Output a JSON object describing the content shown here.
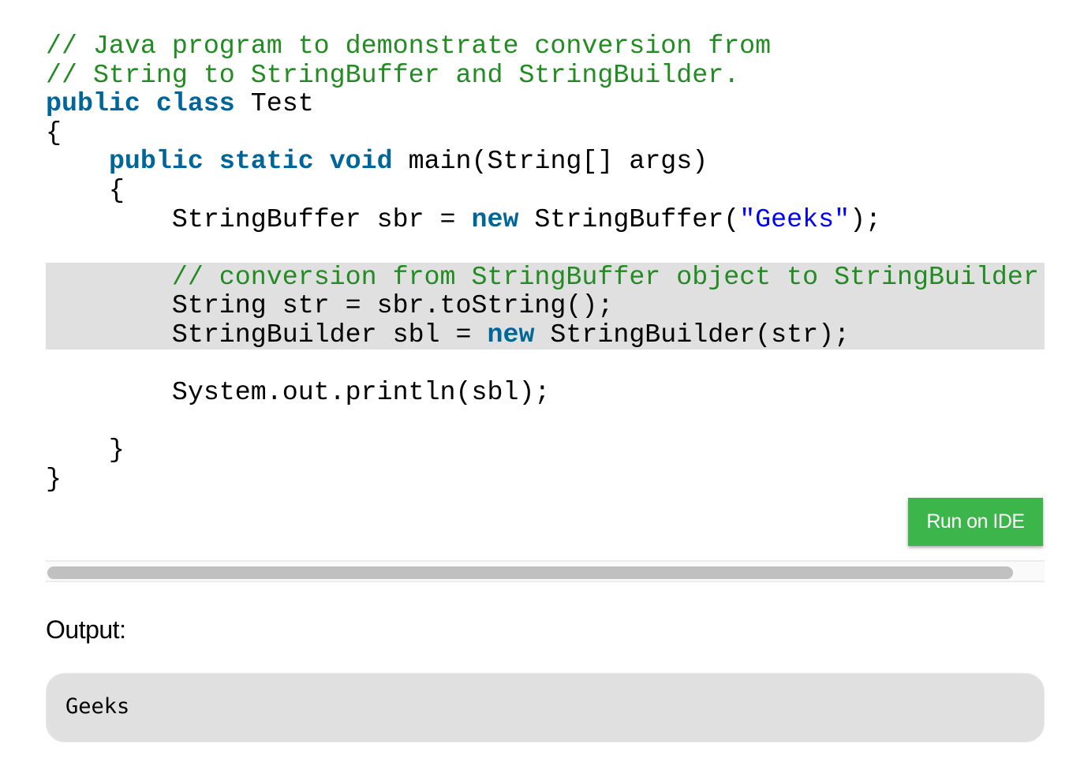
{
  "code": {
    "language": "Java",
    "lines": [
      {
        "highlight": false,
        "tokens": [
          {
            "type": "comment",
            "text": "// Java program to demonstrate conversion from"
          }
        ]
      },
      {
        "highlight": false,
        "tokens": [
          {
            "type": "comment",
            "text": "// String to StringBuffer and StringBuilder."
          }
        ]
      },
      {
        "highlight": false,
        "tokens": [
          {
            "type": "keyword",
            "text": "public"
          },
          {
            "type": "plain",
            "text": " "
          },
          {
            "type": "keyword",
            "text": "class"
          },
          {
            "type": "plain",
            "text": " Test"
          }
        ]
      },
      {
        "highlight": false,
        "tokens": [
          {
            "type": "plain",
            "text": "{"
          }
        ]
      },
      {
        "highlight": false,
        "tokens": [
          {
            "type": "plain",
            "text": "    "
          },
          {
            "type": "keyword",
            "text": "public"
          },
          {
            "type": "plain",
            "text": " "
          },
          {
            "type": "keyword",
            "text": "static"
          },
          {
            "type": "plain",
            "text": " "
          },
          {
            "type": "keyword",
            "text": "void"
          },
          {
            "type": "plain",
            "text": " main(String[] args)"
          }
        ]
      },
      {
        "highlight": false,
        "tokens": [
          {
            "type": "plain",
            "text": "    {"
          }
        ]
      },
      {
        "highlight": false,
        "tokens": [
          {
            "type": "plain",
            "text": "        StringBuffer sbr = "
          },
          {
            "type": "keyword",
            "text": "new"
          },
          {
            "type": "plain",
            "text": " StringBuffer("
          },
          {
            "type": "string",
            "text": "\"Geeks\""
          },
          {
            "type": "plain",
            "text": ");"
          }
        ]
      },
      {
        "highlight": false,
        "tokens": [
          {
            "type": "plain",
            "text": ""
          }
        ]
      },
      {
        "highlight": true,
        "tokens": [
          {
            "type": "plain",
            "text": "        "
          },
          {
            "type": "comment",
            "text": "// conversion from StringBuffer object to StringBuilder"
          }
        ]
      },
      {
        "highlight": true,
        "tokens": [
          {
            "type": "plain",
            "text": "        String str = sbr.toString();"
          }
        ]
      },
      {
        "highlight": true,
        "tokens": [
          {
            "type": "plain",
            "text": "        StringBuilder sbl = "
          },
          {
            "type": "keyword",
            "text": "new"
          },
          {
            "type": "plain",
            "text": " StringBuilder(str);"
          }
        ]
      },
      {
        "highlight": false,
        "tokens": [
          {
            "type": "plain",
            "text": ""
          }
        ]
      },
      {
        "highlight": false,
        "tokens": [
          {
            "type": "plain",
            "text": "        System.out.println(sbl);"
          }
        ]
      },
      {
        "highlight": false,
        "tokens": [
          {
            "type": "plain",
            "text": ""
          }
        ]
      },
      {
        "highlight": false,
        "tokens": [
          {
            "type": "plain",
            "text": "    }"
          }
        ]
      },
      {
        "highlight": false,
        "tokens": [
          {
            "type": "plain",
            "text": "}"
          }
        ]
      }
    ]
  },
  "run_button": {
    "label": "Run on IDE",
    "color": "#3cb54b"
  },
  "scrollbar": {
    "thumb_fraction": 0.97,
    "position_fraction": 0.0
  },
  "output": {
    "label": "Output:",
    "text": "Geeks"
  },
  "colors": {
    "comment": "#228b22",
    "keyword": "#006699",
    "string": "#0000ff",
    "highlight_bg": "#e0e0e0"
  }
}
